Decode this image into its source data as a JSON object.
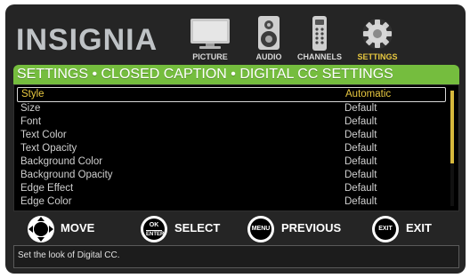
{
  "brand": {
    "logo": "INSIGNIA"
  },
  "nav": {
    "items": [
      {
        "label": "PICTURE",
        "icon": "tv-icon"
      },
      {
        "label": "AUDIO",
        "icon": "speaker-icon"
      },
      {
        "label": "CHANNELS",
        "icon": "remote-icon"
      },
      {
        "label": "SETTINGS",
        "icon": "gear-icon",
        "active": true
      }
    ]
  },
  "breadcrumb": "SETTINGS • CLOSED CAPTION • DIGITAL CC SETTINGS",
  "settings": [
    {
      "name": "Style",
      "value": "Automatic",
      "selected": true
    },
    {
      "name": "Size",
      "value": "Default"
    },
    {
      "name": "Font",
      "value": "Default"
    },
    {
      "name": "Text Color",
      "value": "Default"
    },
    {
      "name": "Text Opacity",
      "value": "Default"
    },
    {
      "name": "Background Color",
      "value": "Default"
    },
    {
      "name": "Background Opacity",
      "value": "Default"
    },
    {
      "name": "Edge Effect",
      "value": "Default"
    },
    {
      "name": "Edge Color",
      "value": "Default"
    }
  ],
  "controls": {
    "move": "MOVE",
    "select": "SELECT",
    "select_btn_top": "OK",
    "select_btn_bottom": "ENTER",
    "previous": "PREVIOUS",
    "previous_btn": "MENU",
    "exit": "EXIT",
    "exit_btn": "EXIT"
  },
  "help_text": "Set the look of Digital CC.",
  "colors": {
    "accent_green": "#75bd3e",
    "highlight_yellow": "#e8c840",
    "background": "#252525"
  }
}
